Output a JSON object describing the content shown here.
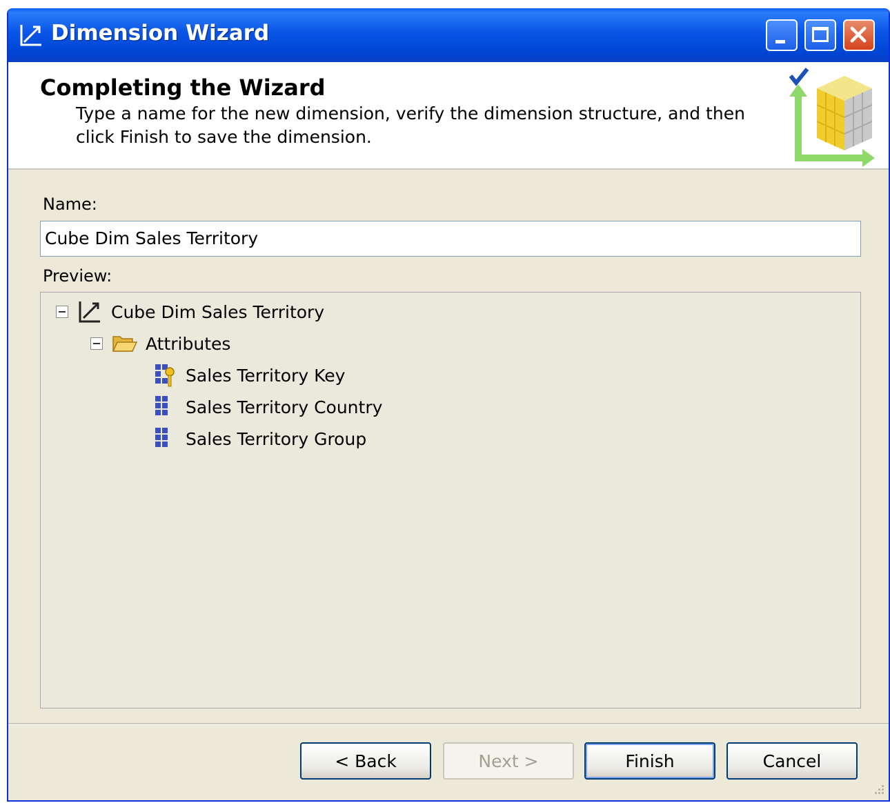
{
  "window": {
    "title": "Dimension Wizard",
    "controls": {
      "minimize_icon": "minimize-icon",
      "maximize_icon": "maximize-icon",
      "close_icon": "close-icon"
    }
  },
  "header": {
    "title": "Completing the Wizard",
    "description": "Type a name for the new dimension, verify the dimension structure, and then click Finish to save the dimension."
  },
  "form": {
    "name_label": "Name:",
    "name_value": "Cube Dim Sales Territory",
    "preview_label": "Preview:"
  },
  "tree": {
    "root": {
      "label": "Cube Dim Sales Territory",
      "icon": "dimension-icon",
      "expanded": true
    },
    "folder": {
      "label": "Attributes",
      "icon": "folder-open-icon",
      "expanded": true
    },
    "items": [
      {
        "label": "Sales Territory Key",
        "icon": "key-attribute-icon"
      },
      {
        "label": "Sales Territory Country",
        "icon": "attribute-icon"
      },
      {
        "label": "Sales Territory Group",
        "icon": "attribute-icon"
      }
    ]
  },
  "buttons": {
    "back": "< Back",
    "next": "Next >",
    "finish": "Finish",
    "cancel": "Cancel"
  },
  "colors": {
    "titlebar": "#0046d5",
    "dialog_bg": "#ece9d8",
    "preview_bg": "#ebe9dc"
  }
}
